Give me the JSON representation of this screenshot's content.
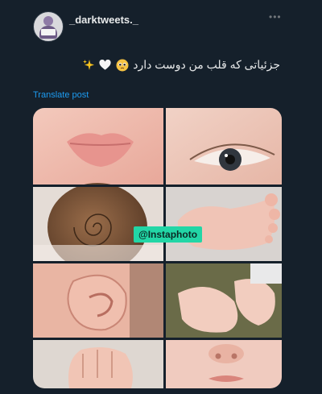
{
  "post": {
    "username": "_darktweets._",
    "text": "جزئیاتی که قلب من دوست دارد",
    "emoji_names": [
      "pleading-face",
      "white-heart",
      "sparkles"
    ],
    "translate_label": "Translate post"
  },
  "media": {
    "watermark": "@Instaphoto",
    "images": [
      "lips",
      "eye",
      "hair-swirl",
      "foot",
      "ear",
      "feet-toes",
      "fist-hand",
      "nose-mouth"
    ]
  },
  "colors": {
    "background": "#15202b",
    "link": "#1d9bf0",
    "text": "#e7e9ea",
    "watermark_bg": "#22d6a6"
  }
}
